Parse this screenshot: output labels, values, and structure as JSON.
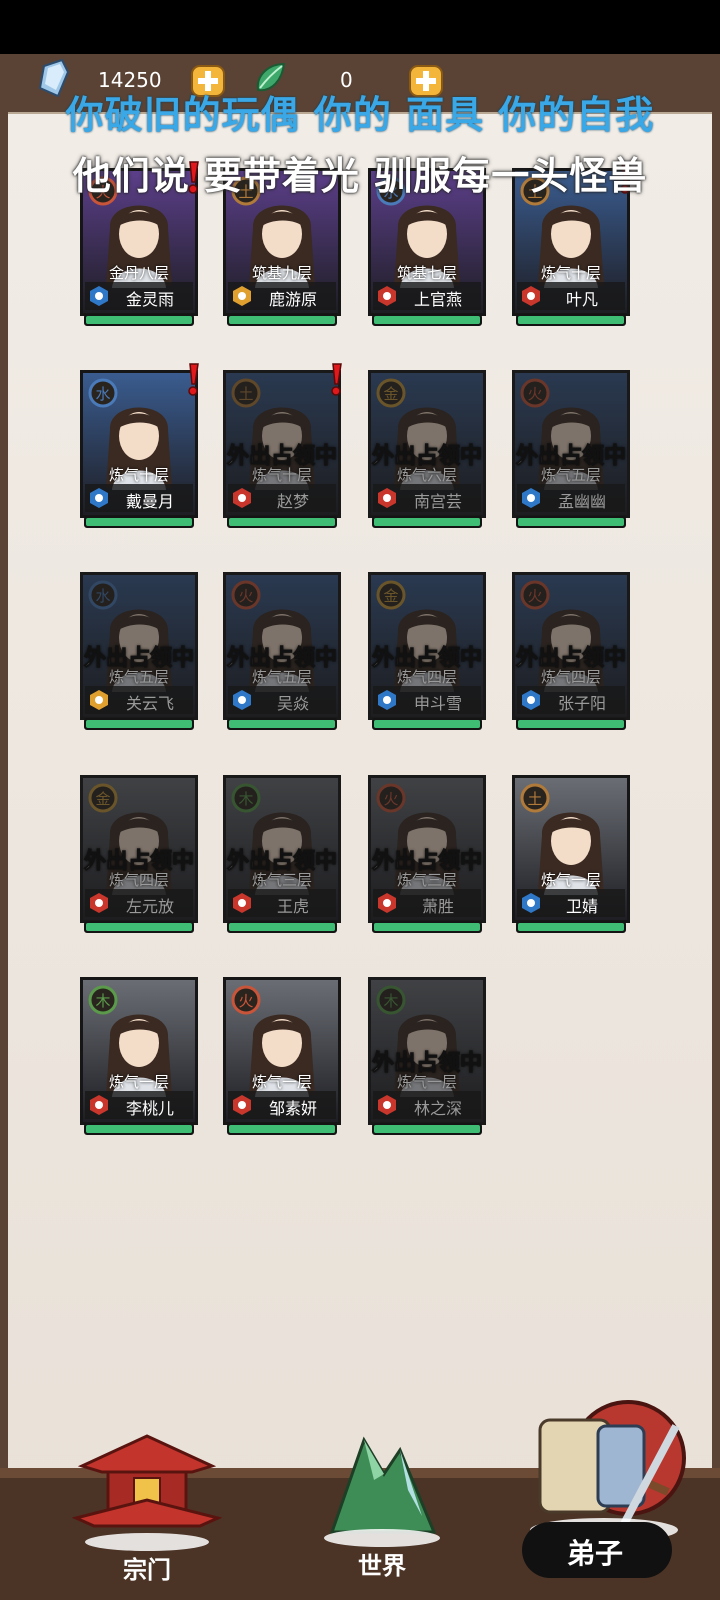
{
  "resources": {
    "spirit_stones": "14250",
    "jade": "0"
  },
  "overlay_lyrics": [
    "你破旧的玩偶 你的 面具 你的自我",
    "他们说 要带着光 驯服每一头怪兽"
  ],
  "away_text": "外出占领中",
  "disciples": [
    {
      "name": "金灵雨",
      "realm": "金丹八层",
      "element": "火",
      "sect": "water",
      "away": false,
      "alert": true,
      "theme": "purple"
    },
    {
      "name": "鹿游原",
      "realm": "筑基九层",
      "element": "土",
      "sect": "earth",
      "away": false,
      "alert": false,
      "theme": "purple"
    },
    {
      "name": "上官燕",
      "realm": "筑基七层",
      "element": "水",
      "sect": "fire",
      "away": false,
      "alert": false,
      "theme": "purple"
    },
    {
      "name": "叶凡",
      "realm": "炼气十层",
      "element": "土",
      "sect": "fire",
      "away": false,
      "alert": true,
      "theme": "blue"
    },
    {
      "name": "戴曼月",
      "realm": "炼气十层",
      "element": "水",
      "sect": "water",
      "away": false,
      "alert": true,
      "theme": "blue"
    },
    {
      "name": "赵梦",
      "realm": "炼气十层",
      "element": "土",
      "sect": "fire",
      "away": true,
      "alert": true,
      "theme": "blue"
    },
    {
      "name": "南宫芸",
      "realm": "炼气六层",
      "element": "金",
      "sect": "fire",
      "away": true,
      "alert": false,
      "theme": "blue"
    },
    {
      "name": "孟幽幽",
      "realm": "炼气五层",
      "element": "火",
      "sect": "water",
      "away": true,
      "alert": false,
      "theme": "blue"
    },
    {
      "name": "关云飞",
      "realm": "炼气五层",
      "element": "水",
      "sect": "earth",
      "away": true,
      "alert": false,
      "theme": "blue"
    },
    {
      "name": "吴焱",
      "realm": "炼气五层",
      "element": "火",
      "sect": "water",
      "away": true,
      "alert": false,
      "theme": "blue"
    },
    {
      "name": "申斗雪",
      "realm": "炼气四层",
      "element": "金",
      "sect": "water",
      "away": true,
      "alert": false,
      "theme": "blue"
    },
    {
      "name": "张子阳",
      "realm": "炼气四层",
      "element": "火",
      "sect": "water",
      "away": true,
      "alert": false,
      "theme": "blue"
    },
    {
      "name": "左元放",
      "realm": "炼气四层",
      "element": "金",
      "sect": "fire",
      "away": true,
      "alert": false,
      "theme": "gray"
    },
    {
      "name": "王虎",
      "realm": "炼气三层",
      "element": "木",
      "sect": "fire",
      "away": true,
      "alert": false,
      "theme": "gray"
    },
    {
      "name": "萧胜",
      "realm": "炼气三层",
      "element": "火",
      "sect": "fire",
      "away": true,
      "alert": false,
      "theme": "gray"
    },
    {
      "name": "卫婧",
      "realm": "炼气一层",
      "element": "土",
      "sect": "water",
      "away": false,
      "alert": false,
      "theme": "gray"
    },
    {
      "name": "李桃儿",
      "realm": "炼气一层",
      "element": "木",
      "sect": "fire",
      "away": false,
      "alert": false,
      "theme": "gray"
    },
    {
      "name": "邹素妍",
      "realm": "炼气一层",
      "element": "火",
      "sect": "fire",
      "away": false,
      "alert": false,
      "theme": "gray"
    },
    {
      "name": "林之深",
      "realm": "炼气一层",
      "element": "木",
      "sect": "fire",
      "away": true,
      "alert": false,
      "theme": "gray"
    }
  ],
  "nav": {
    "sect": "宗门",
    "world": "世界",
    "disciples": "弟子"
  },
  "colors": {
    "purple_card": "#5c3f8a",
    "blue_card": "#3a5c8f",
    "gray_card": "#6a6e74",
    "hp_green": "#3fbd74",
    "lyric_blue": "#3aa7e6"
  }
}
